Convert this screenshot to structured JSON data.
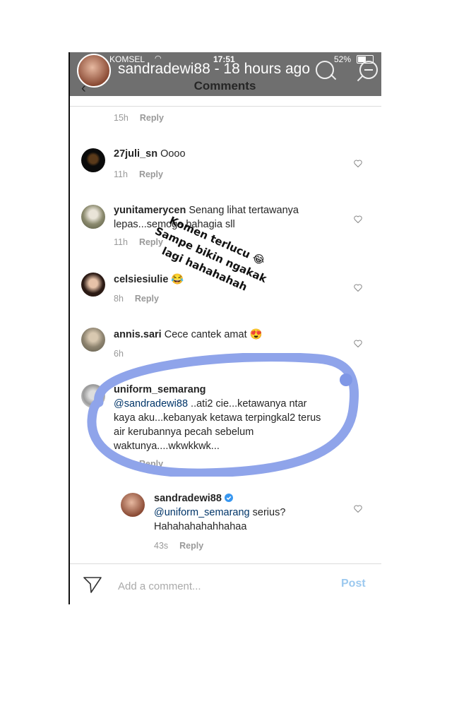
{
  "status_bar": {
    "carrier": "KOMSEL",
    "time": "17:51",
    "battery": "52%"
  },
  "story_header": {
    "title": "sandradewi88 - 18 hours ago"
  },
  "header": {
    "title": "Comments",
    "back_glyph": "‹"
  },
  "overlay_text": {
    "line1": "Komen terlucu 😂",
    "line2": "Sampe bikin ngakak",
    "line3": "lagi hahahahah"
  },
  "comments": [
    {
      "user": "",
      "text": "",
      "time": "15h",
      "reply": "Reply"
    },
    {
      "user": "27juli_sn",
      "text": "Oooo",
      "time": "11h",
      "reply": "Reply"
    },
    {
      "user": "yunitamerycen",
      "text": "Senang lihat tertawanya lepas...semoga bahagia sll",
      "time": "11h",
      "reply": "Reply"
    },
    {
      "user": "celsiesiulie",
      "text": "😂",
      "time": "8h",
      "reply": "Reply"
    },
    {
      "user": "annis.sari",
      "text": "Cece cantek amat 😍",
      "time": "6h",
      "reply": ""
    },
    {
      "user": "uniform_semarang",
      "mention": "@sandradewi88",
      "text": "..ati2 cie...ketawanya ntar kaya aku...kebanyak ketawa terpingkal2 terus air kerubannya pecah sebelum waktunya....wkwkkwk...",
      "time": "",
      "reply": "Reply"
    },
    {
      "user": "sandradewi88",
      "mention": "@uniform_semarang",
      "text": "serius? Hahahahahahhahaa",
      "time": "43s",
      "reply": "Reply"
    }
  ],
  "composer": {
    "placeholder": "Add a comment...",
    "post_label": "Post"
  },
  "colors": {
    "header_bg": "#6f6f6f",
    "mention": "#003569",
    "post": "#9cc9ef",
    "marker": "#8fa4ea"
  },
  "icons": [
    "search-zoom-in-icon",
    "search-zoom-out-icon",
    "heart-icon",
    "send-icon",
    "verified-badge-icon",
    "wifi-icon",
    "battery-icon"
  ]
}
